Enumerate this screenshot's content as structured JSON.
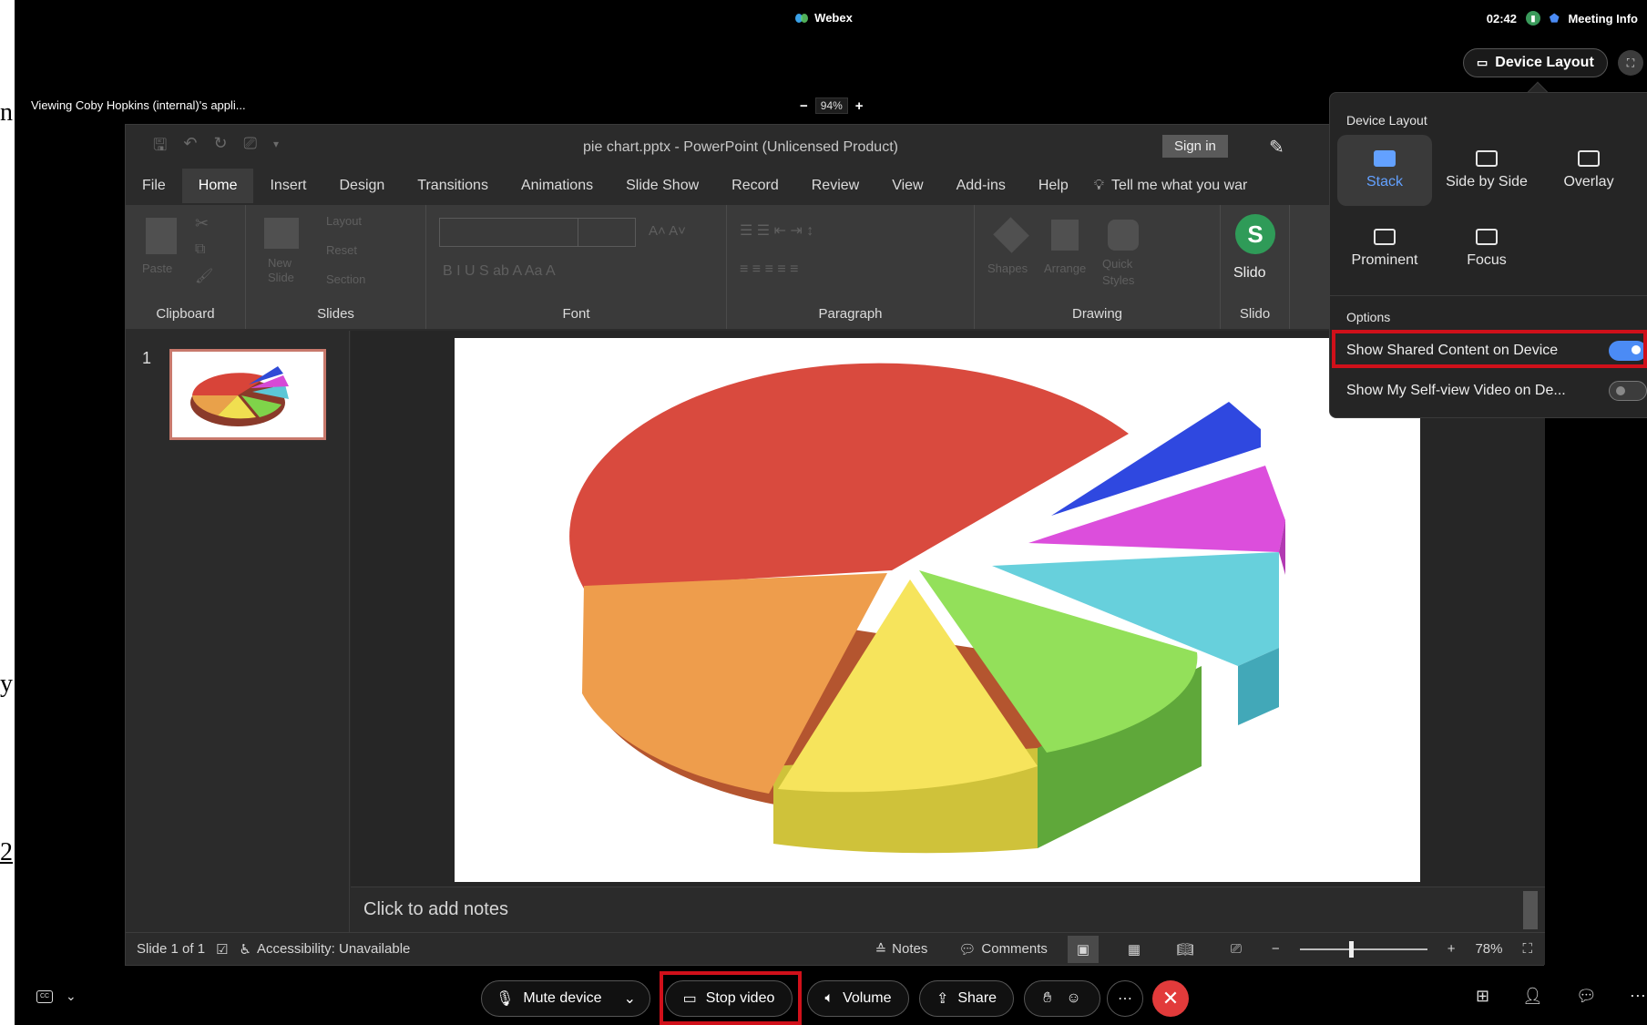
{
  "app": {
    "title": "Webex",
    "time": "02:42",
    "meeting_info": "Meeting Info"
  },
  "device_layout_button": "Device Layout",
  "viewing": "Viewing Coby Hopkins (internal)'s appli...",
  "zoom": {
    "minus": "−",
    "value": "94%",
    "plus": "+"
  },
  "left_sliver": [
    "n",
    "y",
    "2"
  ],
  "ppt": {
    "title": "pie chart.pptx  -  PowerPoint (Unlicensed Product)",
    "sign_in": "Sign in",
    "tabs": [
      "File",
      "Home",
      "Insert",
      "Design",
      "Transitions",
      "Animations",
      "Slide Show",
      "Record",
      "Review",
      "View",
      "Add-ins",
      "Help"
    ],
    "tell_me": "Tell me what you war",
    "groups": {
      "clipboard": "Clipboard",
      "slides": "Slides",
      "font": "Font",
      "paragraph": "Paragraph",
      "drawing": "Drawing",
      "slido": "Slido"
    },
    "ribbon_labels": {
      "paste": "Paste",
      "new_slide": "New Slide",
      "layout": "Layout",
      "reset": "Reset",
      "section": "Section",
      "shapes": "Shapes",
      "arrange": "Arrange",
      "quick_styles": "Quick Styles",
      "slido_btn": "Slido"
    },
    "slide_number": "1",
    "notes_placeholder": "Click to add notes",
    "status": {
      "slide": "Slide 1 of 1",
      "accessibility": "Accessibility: Unavailable",
      "notes": "Notes",
      "comments": "Comments",
      "zoom": "78%"
    }
  },
  "popup": {
    "heading": "Device Layout",
    "layouts": [
      "Stack",
      "Side by Side",
      "Overlay",
      "Prominent",
      "Focus"
    ],
    "selected": "Stack",
    "options_heading": "Options",
    "options": [
      {
        "label": "Show Shared Content on Device",
        "on": true
      },
      {
        "label": "Show My Self-view Video on De...",
        "on": false
      }
    ]
  },
  "controls": {
    "mute": "Mute device",
    "stop_video": "Stop video",
    "volume": "Volume",
    "share": "Share"
  },
  "colors": {
    "accent": "#4b8bf5",
    "end_call": "#e23b3b",
    "highlight": "#d0101a",
    "slido": "#2f9b58"
  }
}
